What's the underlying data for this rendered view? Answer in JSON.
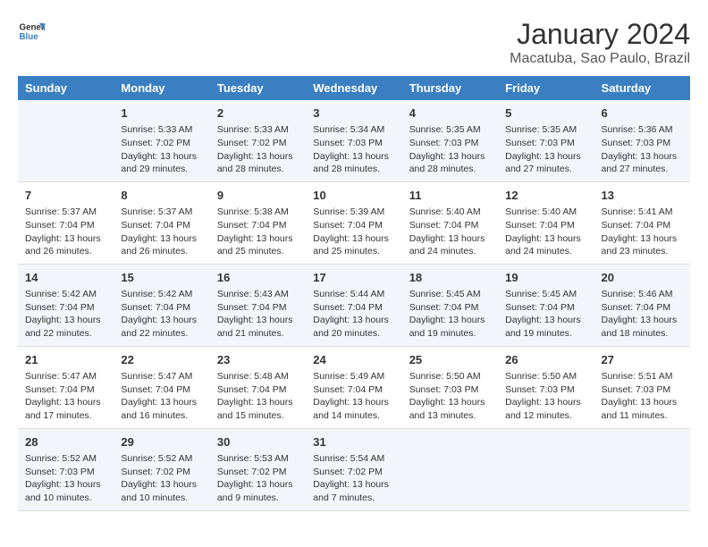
{
  "logo": {
    "line1": "General",
    "line2": "Blue"
  },
  "title": "January 2024",
  "subtitle": "Macatuba, Sao Paulo, Brazil",
  "days_header": [
    "Sunday",
    "Monday",
    "Tuesday",
    "Wednesday",
    "Thursday",
    "Friday",
    "Saturday"
  ],
  "weeks": [
    [
      {
        "num": "",
        "sunrise": "",
        "sunset": "",
        "daylight": ""
      },
      {
        "num": "1",
        "sunrise": "Sunrise: 5:33 AM",
        "sunset": "Sunset: 7:02 PM",
        "daylight": "Daylight: 13 hours and 29 minutes."
      },
      {
        "num": "2",
        "sunrise": "Sunrise: 5:33 AM",
        "sunset": "Sunset: 7:02 PM",
        "daylight": "Daylight: 13 hours and 28 minutes."
      },
      {
        "num": "3",
        "sunrise": "Sunrise: 5:34 AM",
        "sunset": "Sunset: 7:03 PM",
        "daylight": "Daylight: 13 hours and 28 minutes."
      },
      {
        "num": "4",
        "sunrise": "Sunrise: 5:35 AM",
        "sunset": "Sunset: 7:03 PM",
        "daylight": "Daylight: 13 hours and 28 minutes."
      },
      {
        "num": "5",
        "sunrise": "Sunrise: 5:35 AM",
        "sunset": "Sunset: 7:03 PM",
        "daylight": "Daylight: 13 hours and 27 minutes."
      },
      {
        "num": "6",
        "sunrise": "Sunrise: 5:36 AM",
        "sunset": "Sunset: 7:03 PM",
        "daylight": "Daylight: 13 hours and 27 minutes."
      }
    ],
    [
      {
        "num": "7",
        "sunrise": "Sunrise: 5:37 AM",
        "sunset": "Sunset: 7:04 PM",
        "daylight": "Daylight: 13 hours and 26 minutes."
      },
      {
        "num": "8",
        "sunrise": "Sunrise: 5:37 AM",
        "sunset": "Sunset: 7:04 PM",
        "daylight": "Daylight: 13 hours and 26 minutes."
      },
      {
        "num": "9",
        "sunrise": "Sunrise: 5:38 AM",
        "sunset": "Sunset: 7:04 PM",
        "daylight": "Daylight: 13 hours and 25 minutes."
      },
      {
        "num": "10",
        "sunrise": "Sunrise: 5:39 AM",
        "sunset": "Sunset: 7:04 PM",
        "daylight": "Daylight: 13 hours and 25 minutes."
      },
      {
        "num": "11",
        "sunrise": "Sunrise: 5:40 AM",
        "sunset": "Sunset: 7:04 PM",
        "daylight": "Daylight: 13 hours and 24 minutes."
      },
      {
        "num": "12",
        "sunrise": "Sunrise: 5:40 AM",
        "sunset": "Sunset: 7:04 PM",
        "daylight": "Daylight: 13 hours and 24 minutes."
      },
      {
        "num": "13",
        "sunrise": "Sunrise: 5:41 AM",
        "sunset": "Sunset: 7:04 PM",
        "daylight": "Daylight: 13 hours and 23 minutes."
      }
    ],
    [
      {
        "num": "14",
        "sunrise": "Sunrise: 5:42 AM",
        "sunset": "Sunset: 7:04 PM",
        "daylight": "Daylight: 13 hours and 22 minutes."
      },
      {
        "num": "15",
        "sunrise": "Sunrise: 5:42 AM",
        "sunset": "Sunset: 7:04 PM",
        "daylight": "Daylight: 13 hours and 22 minutes."
      },
      {
        "num": "16",
        "sunrise": "Sunrise: 5:43 AM",
        "sunset": "Sunset: 7:04 PM",
        "daylight": "Daylight: 13 hours and 21 minutes."
      },
      {
        "num": "17",
        "sunrise": "Sunrise: 5:44 AM",
        "sunset": "Sunset: 7:04 PM",
        "daylight": "Daylight: 13 hours and 20 minutes."
      },
      {
        "num": "18",
        "sunrise": "Sunrise: 5:45 AM",
        "sunset": "Sunset: 7:04 PM",
        "daylight": "Daylight: 13 hours and 19 minutes."
      },
      {
        "num": "19",
        "sunrise": "Sunrise: 5:45 AM",
        "sunset": "Sunset: 7:04 PM",
        "daylight": "Daylight: 13 hours and 19 minutes."
      },
      {
        "num": "20",
        "sunrise": "Sunrise: 5:46 AM",
        "sunset": "Sunset: 7:04 PM",
        "daylight": "Daylight: 13 hours and 18 minutes."
      }
    ],
    [
      {
        "num": "21",
        "sunrise": "Sunrise: 5:47 AM",
        "sunset": "Sunset: 7:04 PM",
        "daylight": "Daylight: 13 hours and 17 minutes."
      },
      {
        "num": "22",
        "sunrise": "Sunrise: 5:47 AM",
        "sunset": "Sunset: 7:04 PM",
        "daylight": "Daylight: 13 hours and 16 minutes."
      },
      {
        "num": "23",
        "sunrise": "Sunrise: 5:48 AM",
        "sunset": "Sunset: 7:04 PM",
        "daylight": "Daylight: 13 hours and 15 minutes."
      },
      {
        "num": "24",
        "sunrise": "Sunrise: 5:49 AM",
        "sunset": "Sunset: 7:04 PM",
        "daylight": "Daylight: 13 hours and 14 minutes."
      },
      {
        "num": "25",
        "sunrise": "Sunrise: 5:50 AM",
        "sunset": "Sunset: 7:03 PM",
        "daylight": "Daylight: 13 hours and 13 minutes."
      },
      {
        "num": "26",
        "sunrise": "Sunrise: 5:50 AM",
        "sunset": "Sunset: 7:03 PM",
        "daylight": "Daylight: 13 hours and 12 minutes."
      },
      {
        "num": "27",
        "sunrise": "Sunrise: 5:51 AM",
        "sunset": "Sunset: 7:03 PM",
        "daylight": "Daylight: 13 hours and 11 minutes."
      }
    ],
    [
      {
        "num": "28",
        "sunrise": "Sunrise: 5:52 AM",
        "sunset": "Sunset: 7:03 PM",
        "daylight": "Daylight: 13 hours and 10 minutes."
      },
      {
        "num": "29",
        "sunrise": "Sunrise: 5:52 AM",
        "sunset": "Sunset: 7:02 PM",
        "daylight": "Daylight: 13 hours and 10 minutes."
      },
      {
        "num": "30",
        "sunrise": "Sunrise: 5:53 AM",
        "sunset": "Sunset: 7:02 PM",
        "daylight": "Daylight: 13 hours and 9 minutes."
      },
      {
        "num": "31",
        "sunrise": "Sunrise: 5:54 AM",
        "sunset": "Sunset: 7:02 PM",
        "daylight": "Daylight: 13 hours and 7 minutes."
      },
      {
        "num": "",
        "sunrise": "",
        "sunset": "",
        "daylight": ""
      },
      {
        "num": "",
        "sunrise": "",
        "sunset": "",
        "daylight": ""
      },
      {
        "num": "",
        "sunrise": "",
        "sunset": "",
        "daylight": ""
      }
    ]
  ]
}
